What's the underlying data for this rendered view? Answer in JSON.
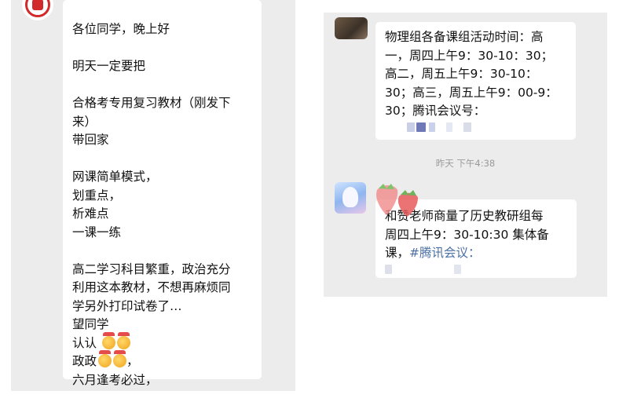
{
  "left_chat": {
    "message_lines": [
      "各位同学，晚上好",
      "",
      "明天一定要把",
      "",
      "合格考专用复习教材（刚发下",
      "来）",
      "带回家",
      "",
      "网课简单模式，",
      "划重点，",
      "析难点",
      "一课一练",
      "",
      "高二学习科目繁重，政治充分",
      "利用这本教材，不想再麻烦同",
      "学另外打印试卷了…",
      "望同学"
    ],
    "renren": "认认",
    "zhengzheng": "政政",
    "zhengzheng_suffix": "，",
    "last_line": "六月逢考必过，"
  },
  "right_chat": {
    "message1_lines": [
      "物理组各备课组活动时间：高",
      "一，周四上午9：30-10：30；",
      "高二，周五上午9：30-10：",
      "30；高三，周五上午9：00-9：",
      "30；腾讯会议号："
    ],
    "timestamp": "昨天 下午4:38",
    "message2_line1": "和赞老师商量了历史教研组每",
    "message2_line2": "周四上午9：30-10:30 集体备",
    "message2_line3_prefix": "课，",
    "message2_link": "#腾讯会议：",
    "colors": {
      "link": "#4a6fa5",
      "panel_bg": "#ececec",
      "bubble_bg": "#ffffff"
    }
  }
}
